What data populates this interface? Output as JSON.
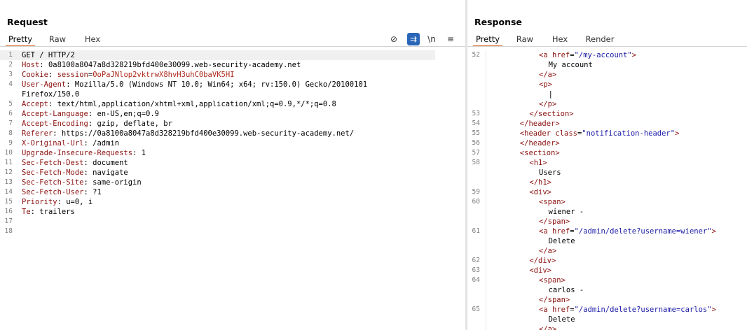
{
  "request": {
    "title": "Request",
    "tabs": [
      "Pretty",
      "Raw",
      "Hex"
    ],
    "active_tab": "Pretty",
    "toolbar": [
      {
        "name": "hide-nonprintable-icon",
        "glyph": "⊘",
        "active": false
      },
      {
        "name": "wrap-lines-icon",
        "glyph": "⇉",
        "active": true
      },
      {
        "name": "newline-toggle-icon",
        "glyph": "\\n",
        "active": false
      },
      {
        "name": "menu-icon",
        "glyph": "≡",
        "active": false
      }
    ],
    "lines": [
      {
        "n": "1",
        "parts": [
          [
            "plain",
            "GET / HTTP/2"
          ]
        ],
        "current": true
      },
      {
        "n": "2",
        "parts": [
          [
            "k",
            "Host"
          ],
          [
            "plain",
            ": 0a8100a8047a8d328219bfd400e30099.web-security-academy.net"
          ]
        ]
      },
      {
        "n": "3",
        "parts": [
          [
            "k",
            "Cookie"
          ],
          [
            "plain",
            ": "
          ],
          [
            "k",
            "session"
          ],
          [
            "plain",
            "="
          ],
          [
            "v",
            "0oPaJNlop2vktrwX8hvH3uhC0baVK5HI"
          ]
        ]
      },
      {
        "n": "4",
        "parts": [
          [
            "k",
            "User-Agent"
          ],
          [
            "plain",
            ": Mozilla/5.0 (Windows NT 10.0; Win64; x64; rv:150.0) Gecko/20100101"
          ]
        ]
      },
      {
        "n": "",
        "parts": [
          [
            "plain",
            "Firefox/150.0"
          ]
        ]
      },
      {
        "n": "5",
        "parts": [
          [
            "k",
            "Accept"
          ],
          [
            "plain",
            ": text/html,application/xhtml+xml,application/xml;q=0.9,*/*;q=0.8"
          ]
        ]
      },
      {
        "n": "6",
        "parts": [
          [
            "k",
            "Accept-Language"
          ],
          [
            "plain",
            ": en-US,en;q=0.9"
          ]
        ]
      },
      {
        "n": "7",
        "parts": [
          [
            "k",
            "Accept-Encoding"
          ],
          [
            "plain",
            ": gzip, deflate, br"
          ]
        ]
      },
      {
        "n": "8",
        "parts": [
          [
            "k",
            "Referer"
          ],
          [
            "plain",
            ": https://0a8100a8047a8d328219bfd400e30099.web-security-academy.net/"
          ]
        ]
      },
      {
        "n": "9",
        "parts": [
          [
            "k",
            "X-Original-Url"
          ],
          [
            "plain",
            ": /admin"
          ]
        ]
      },
      {
        "n": "10",
        "parts": [
          [
            "k",
            "Upgrade-Insecure-Requests"
          ],
          [
            "plain",
            ": 1"
          ]
        ]
      },
      {
        "n": "11",
        "parts": [
          [
            "k",
            "Sec-Fetch-Dest"
          ],
          [
            "plain",
            ": document"
          ]
        ]
      },
      {
        "n": "12",
        "parts": [
          [
            "k",
            "Sec-Fetch-Mode"
          ],
          [
            "plain",
            ": navigate"
          ]
        ]
      },
      {
        "n": "13",
        "parts": [
          [
            "k",
            "Sec-Fetch-Site"
          ],
          [
            "plain",
            ": same-origin"
          ]
        ]
      },
      {
        "n": "14",
        "parts": [
          [
            "k",
            "Sec-Fetch-User"
          ],
          [
            "plain",
            ": ?1"
          ]
        ]
      },
      {
        "n": "15",
        "parts": [
          [
            "k",
            "Priority"
          ],
          [
            "plain",
            ": u=0, i"
          ]
        ]
      },
      {
        "n": "16",
        "parts": [
          [
            "k",
            "Te"
          ],
          [
            "plain",
            ": trailers"
          ]
        ]
      },
      {
        "n": "17",
        "parts": []
      },
      {
        "n": "18",
        "parts": []
      }
    ]
  },
  "response": {
    "title": "Response",
    "tabs": [
      "Pretty",
      "Raw",
      "Hex",
      "Render"
    ],
    "active_tab": "Pretty",
    "lines": [
      {
        "n": "52",
        "indent": 5,
        "parts": [
          [
            "tag",
            "<a "
          ],
          [
            "attr",
            "href"
          ],
          [
            "plain",
            "="
          ],
          [
            "str",
            "\"/my-account\""
          ],
          [
            "tag",
            ">"
          ]
        ]
      },
      {
        "n": "",
        "indent": 6,
        "parts": [
          [
            "plain",
            "My account"
          ]
        ]
      },
      {
        "n": "",
        "indent": 5,
        "parts": [
          [
            "tag",
            "</a>"
          ]
        ]
      },
      {
        "n": "",
        "indent": 5,
        "parts": [
          [
            "tag",
            "<p>"
          ]
        ]
      },
      {
        "n": "",
        "indent": 6,
        "parts": [
          [
            "plain",
            "|"
          ]
        ]
      },
      {
        "n": "",
        "indent": 5,
        "parts": [
          [
            "tag",
            "</p>"
          ]
        ]
      },
      {
        "n": "53",
        "indent": 4,
        "parts": [
          [
            "tag",
            "</section>"
          ]
        ]
      },
      {
        "n": "54",
        "indent": 3,
        "parts": [
          [
            "tag",
            "</header>"
          ]
        ]
      },
      {
        "n": "55",
        "indent": 3,
        "parts": [
          [
            "tag",
            "<header "
          ],
          [
            "attr",
            "class"
          ],
          [
            "plain",
            "="
          ],
          [
            "str",
            "\"notification-header\""
          ],
          [
            "tag",
            ">"
          ]
        ]
      },
      {
        "n": "56",
        "indent": 3,
        "parts": [
          [
            "tag",
            "</header>"
          ]
        ]
      },
      {
        "n": "57",
        "indent": 3,
        "parts": [
          [
            "tag",
            "<section>"
          ]
        ]
      },
      {
        "n": "58",
        "indent": 4,
        "parts": [
          [
            "tag",
            "<h1>"
          ]
        ]
      },
      {
        "n": "",
        "indent": 5,
        "parts": [
          [
            "plain",
            "Users"
          ]
        ]
      },
      {
        "n": "",
        "indent": 4,
        "parts": [
          [
            "tag",
            "</h1>"
          ]
        ]
      },
      {
        "n": "59",
        "indent": 4,
        "parts": [
          [
            "tag",
            "<div>"
          ]
        ]
      },
      {
        "n": "60",
        "indent": 5,
        "parts": [
          [
            "tag",
            "<span>"
          ]
        ]
      },
      {
        "n": "",
        "indent": 6,
        "parts": [
          [
            "plain",
            "wiener -"
          ]
        ]
      },
      {
        "n": "",
        "indent": 5,
        "parts": [
          [
            "tag",
            "</span>"
          ]
        ]
      },
      {
        "n": "61",
        "indent": 5,
        "parts": [
          [
            "tag",
            "<a "
          ],
          [
            "attr",
            "href"
          ],
          [
            "plain",
            "="
          ],
          [
            "str",
            "\"/admin/delete?username=wiener\""
          ],
          [
            "tag",
            ">"
          ]
        ]
      },
      {
        "n": "",
        "indent": 6,
        "parts": [
          [
            "plain",
            "Delete"
          ]
        ]
      },
      {
        "n": "",
        "indent": 5,
        "parts": [
          [
            "tag",
            "</a>"
          ]
        ]
      },
      {
        "n": "62",
        "indent": 4,
        "parts": [
          [
            "tag",
            "</div>"
          ]
        ]
      },
      {
        "n": "63",
        "indent": 4,
        "parts": [
          [
            "tag",
            "<div>"
          ]
        ]
      },
      {
        "n": "64",
        "indent": 5,
        "parts": [
          [
            "tag",
            "<span>"
          ]
        ]
      },
      {
        "n": "",
        "indent": 6,
        "parts": [
          [
            "plain",
            "carlos -"
          ]
        ]
      },
      {
        "n": "",
        "indent": 5,
        "parts": [
          [
            "tag",
            "</span>"
          ]
        ]
      },
      {
        "n": "65",
        "indent": 5,
        "parts": [
          [
            "tag",
            "<a "
          ],
          [
            "attr",
            "href"
          ],
          [
            "plain",
            "="
          ],
          [
            "str",
            "\"/admin/delete?username=carlos\""
          ],
          [
            "tag",
            ">"
          ]
        ]
      },
      {
        "n": "",
        "indent": 6,
        "parts": [
          [
            "plain",
            "Delete"
          ]
        ]
      },
      {
        "n": "",
        "indent": 5,
        "parts": [
          [
            "tag",
            "</a>"
          ]
        ]
      }
    ]
  }
}
